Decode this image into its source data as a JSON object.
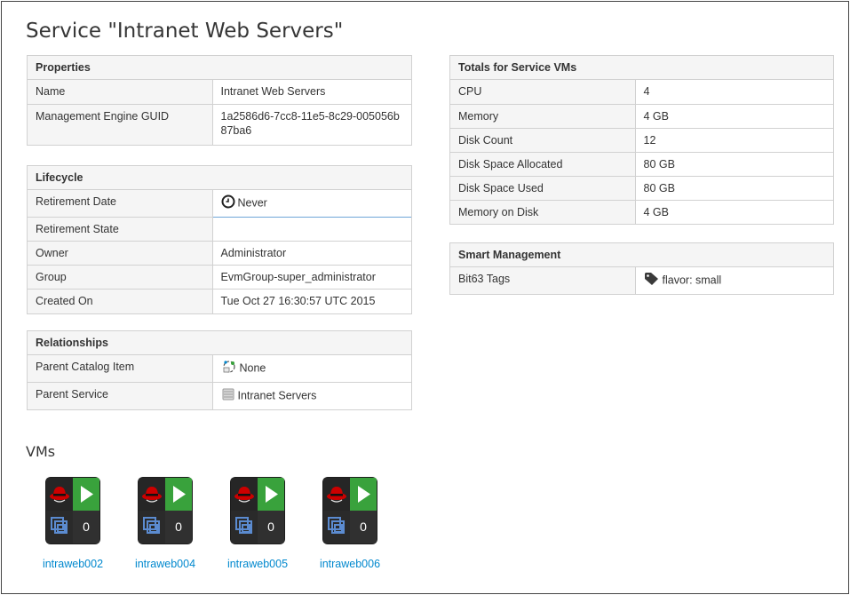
{
  "title": "Service \"Intranet Web Servers\"",
  "properties": {
    "header": "Properties",
    "rows": [
      {
        "label": "Name",
        "value": "Intranet Web Servers"
      },
      {
        "label": "Management Engine GUID",
        "value": "1a2586d6-7cc8-11e5-8c29-005056b87ba6"
      }
    ]
  },
  "lifecycle": {
    "header": "Lifecycle",
    "rows": [
      {
        "label": "Retirement Date",
        "value": "Never",
        "icon": "clock-icon"
      },
      {
        "label": "Retirement State",
        "value": ""
      },
      {
        "label": "Owner",
        "value": "Administrator"
      },
      {
        "label": "Group",
        "value": "EvmGroup-super_administrator"
      },
      {
        "label": "Created On",
        "value": "Tue Oct 27 16:30:57 UTC 2015"
      }
    ]
  },
  "relationships": {
    "header": "Relationships",
    "rows": [
      {
        "label": "Parent Catalog Item",
        "value": "None",
        "icon": "catalog-item-icon"
      },
      {
        "label": "Parent Service",
        "value": "Intranet Servers",
        "icon": "service-icon"
      }
    ]
  },
  "totals": {
    "header": "Totals for Service VMs",
    "rows": [
      {
        "label": "CPU",
        "value": "4"
      },
      {
        "label": "Memory",
        "value": "4 GB"
      },
      {
        "label": "Disk Count",
        "value": "12"
      },
      {
        "label": "Disk Space Allocated",
        "value": "80 GB"
      },
      {
        "label": "Disk Space Used",
        "value": "80 GB"
      },
      {
        "label": "Memory on Disk",
        "value": "4 GB"
      }
    ]
  },
  "smart": {
    "header": "Smart Management",
    "rows": [
      {
        "label": "Bit63 Tags",
        "value": "flavor: small",
        "icon": "tag-icon"
      }
    ]
  },
  "vms": {
    "title": "VMs",
    "items": [
      {
        "name": "intraweb002",
        "count": "0"
      },
      {
        "name": "intraweb004",
        "count": "0"
      },
      {
        "name": "intraweb005",
        "count": "0"
      },
      {
        "name": "intraweb006",
        "count": "0"
      }
    ]
  },
  "colors": {
    "link": "#0088ce",
    "power_on": "#39a23c",
    "redhat_red": "#cc0000"
  }
}
